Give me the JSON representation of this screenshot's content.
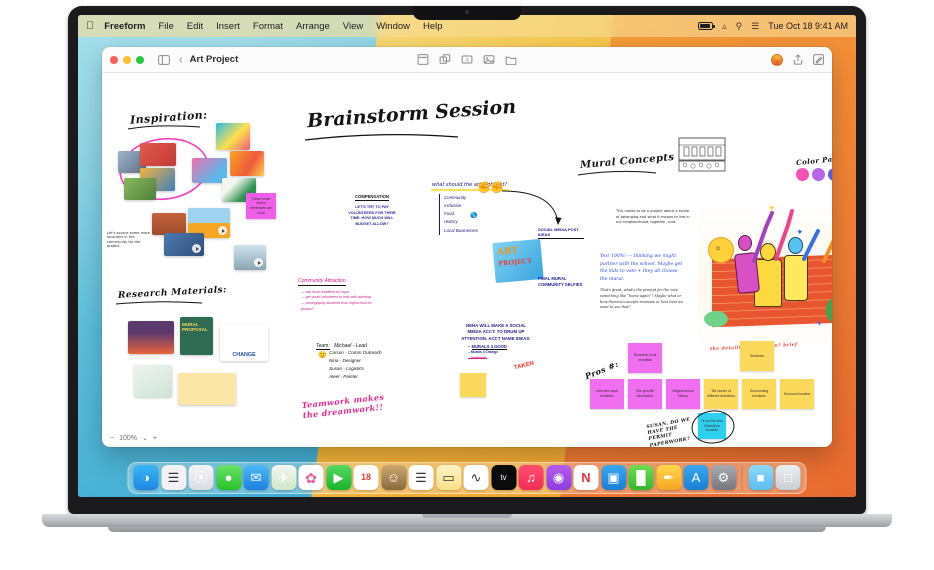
{
  "menubar": {
    "apple_icon": "apple-logo-icon",
    "items": [
      {
        "label": "Freeform",
        "bold": true
      },
      {
        "label": "File"
      },
      {
        "label": "Edit"
      },
      {
        "label": "Insert"
      },
      {
        "label": "Format"
      },
      {
        "label": "Arrange"
      },
      {
        "label": "View"
      },
      {
        "label": "Window"
      },
      {
        "label": "Help"
      }
    ],
    "status": {
      "battery_icon": "battery-icon",
      "wifi_icon": "wifi-icon",
      "search_icon": "spotlight-search-icon",
      "control_center_icon": "control-center-icon",
      "datetime": "Tue Oct 18  9:41 AM"
    }
  },
  "window": {
    "title": "Art Project",
    "sidebar_toggle_icon": "sidebar-toggle-icon",
    "back_icon": "chevron-left-icon",
    "toolbar_center": [
      {
        "name": "sticky-note-icon"
      },
      {
        "name": "shapes-icon"
      },
      {
        "name": "text-box-icon"
      },
      {
        "name": "media-icon"
      },
      {
        "name": "insert-file-icon"
      }
    ],
    "toolbar_right": [
      {
        "name": "collaborate-avatar"
      },
      {
        "name": "share-icon"
      },
      {
        "name": "format-pencil-icon"
      }
    ],
    "zoom": {
      "minus": "−",
      "level": "100%",
      "chevron": "⌄",
      "plus": "+"
    }
  },
  "canvas": {
    "headings": {
      "inspiration": "Inspiration:",
      "brainstorm": "Brainstorm Session",
      "research_materials": "Research Materials:",
      "mural_concepts": "Mural Concepts",
      "color_palette": "Color Palette",
      "pros": "Pros #:"
    },
    "notes_text": {
      "compensation_title": "COMPENSATION",
      "compensation_body": "LET'S TRY TO PAY VOLUNTEERS FOR THEIR TIME. HOW MUCH WILL BUDGET ALLOW?",
      "art_highlight_q": "what should the art highlight?",
      "highlight_list": [
        "Community",
        "Inclusion",
        "Food",
        "History",
        "Local Businesses"
      ],
      "community_attraction_title": "Community Attraction",
      "community_attraction_items": [
        "ask local residents for input",
        "get youth volunteers to help with painting",
        "photography students from highschool for photos?"
      ],
      "social_media_label": "SOCIAL MEDIA POST IDEAS",
      "team_title": "Team:",
      "team_members": [
        "Michael - Lead",
        "Carson - Comm Outreach",
        "Nina - Designer",
        "Susan - Logistics",
        "Aleel - Painter"
      ],
      "neha_note": "NEHA WILL MAKE A SOCIAL MEDIA ACCT. TO DRUM UP ATTENTION. ACCT NAME IDEAS:",
      "acct_ideas": [
        "MURALS 4 GOOD",
        "Murals 4 Change",
        "ArtisWork"
      ],
      "taken_stamp": "TAKEN",
      "teamwork_slogan": "Teamwork makes the dreamwork!!",
      "art_project_sticker": "ART PROJECT",
      "final_mural_label": "FINAL MURAL COMMUNITY SELFIES",
      "belonging_note": "This needs to be a project about a sense of belonging and what it means to live in our neighborhood, together, now.",
      "yes_note": "Yes! 100%! — thinking we might partner with the school. Maybe get the kids to vote + they all choose the mural.",
      "yes_note_2": "That's great, what's the prompt for the vote, something like “home again”? Maybe what or how themes/concepts resonate or how best we want to see that?",
      "sketch_caption": "the details / dimension? brief",
      "souce_locations": "Let's source some more locations in the community for the project.",
      "magenta_note": "These brush stroke references are cool!",
      "scan_note": "SUSAN, DO WE HAVE THE PERMIT PAPERWORK?",
      "cyan_note": "I'll run the final illustration location!"
    },
    "sticky_grid": {
      "row_top": [
        {
          "text": "Research local muralists",
          "color": "pink"
        },
        {
          "text": "Sketches",
          "color": "yellow"
        }
      ],
      "row_bottom": [
        {
          "text": "Interview local residents",
          "color": "pink"
        },
        {
          "text": "Site specific information",
          "color": "pink"
        },
        {
          "text": "Neighborhood history",
          "color": "pink"
        },
        {
          "text": "Tell stories of different directions",
          "color": "yellow"
        },
        {
          "text": "Surrounding emotions",
          "color": "yellow"
        },
        {
          "text": "Surround location",
          "color": "yellow"
        }
      ]
    },
    "color_palette_swatches": [
      "#F54FB8",
      "#B766E8",
      "#5A5AE8",
      "#4FA8F0"
    ],
    "research_docs": [
      {
        "name": "car-mountain-doc"
      },
      {
        "name": "mural-proposal-doc",
        "title": "MURAL PROPOSAL"
      },
      {
        "name": "change-poster-doc",
        "title": "Coming Together for CHANGE"
      },
      {
        "name": "map-doc"
      },
      {
        "name": "food-card-doc"
      }
    ]
  },
  "dock": {
    "items": [
      {
        "name": "finder",
        "glyph": "◑",
        "bg": "linear-gradient(180deg,#38b6f5,#1e88e5)",
        "running": true
      },
      {
        "name": "launchpad",
        "glyph": "☰",
        "bg": "#f2f2f4"
      },
      {
        "name": "safari",
        "glyph": "⦿",
        "bg": "linear-gradient(180deg,#f4f5f7,#d8dce2)"
      },
      {
        "name": "messages",
        "glyph": "●",
        "bg": "linear-gradient(180deg,#6ae26a,#29c229)"
      },
      {
        "name": "mail",
        "glyph": "✉",
        "bg": "linear-gradient(180deg,#4fb9f7,#1e7fe0)"
      },
      {
        "name": "maps",
        "glyph": "✈",
        "bg": "linear-gradient(180deg,#f4f7f2,#cfe6c6)"
      },
      {
        "name": "photos",
        "glyph": "✿",
        "bg": "#ffffff"
      },
      {
        "name": "facetime",
        "glyph": "▶",
        "bg": "linear-gradient(180deg,#56d962,#17b52c)"
      },
      {
        "name": "calendar",
        "glyph": "18",
        "bg": "#ffffff"
      },
      {
        "name": "contacts",
        "glyph": "☺",
        "bg": "linear-gradient(180deg,#caa86f,#8a6a3d)"
      },
      {
        "name": "reminders",
        "glyph": "☰",
        "bg": "#ffffff"
      },
      {
        "name": "notes",
        "glyph": "▭",
        "bg": "linear-gradient(180deg,#fff3c4,#f7e08a)"
      },
      {
        "name": "freeform",
        "glyph": "∿",
        "bg": "#ffffff",
        "running": true
      },
      {
        "name": "apple-tv",
        "glyph": "tv",
        "bg": "#0b0b0d"
      },
      {
        "name": "music",
        "glyph": "♫",
        "bg": "linear-gradient(180deg,#fb4f6f,#f52d55)"
      },
      {
        "name": "podcasts",
        "glyph": "◉",
        "bg": "linear-gradient(180deg,#b45cf0,#8e3ce0)"
      },
      {
        "name": "news",
        "glyph": "N",
        "bg": "#ffffff"
      },
      {
        "name": "keynote",
        "glyph": "▣",
        "bg": "linear-gradient(180deg,#3aa8f0,#1b7fd4)"
      },
      {
        "name": "numbers",
        "glyph": "█",
        "bg": "linear-gradient(180deg,#6fdc55,#34b82a)"
      },
      {
        "name": "pages",
        "glyph": "✒",
        "bg": "linear-gradient(180deg,#ffd84d,#f5a623)"
      },
      {
        "name": "app-store",
        "glyph": "A",
        "bg": "linear-gradient(180deg,#3aa8f0,#1b7fd4)"
      },
      {
        "name": "system-settings",
        "glyph": "⚙",
        "bg": "linear-gradient(180deg,#a9abb0,#76787e)"
      }
    ],
    "trailing": [
      {
        "name": "downloads-folder",
        "glyph": "■",
        "bg": "linear-gradient(180deg,#8fd8f8,#5bbdf0)"
      },
      {
        "name": "trash",
        "glyph": "□",
        "bg": "linear-gradient(180deg,#eceff2,#c9ced4)"
      }
    ]
  }
}
